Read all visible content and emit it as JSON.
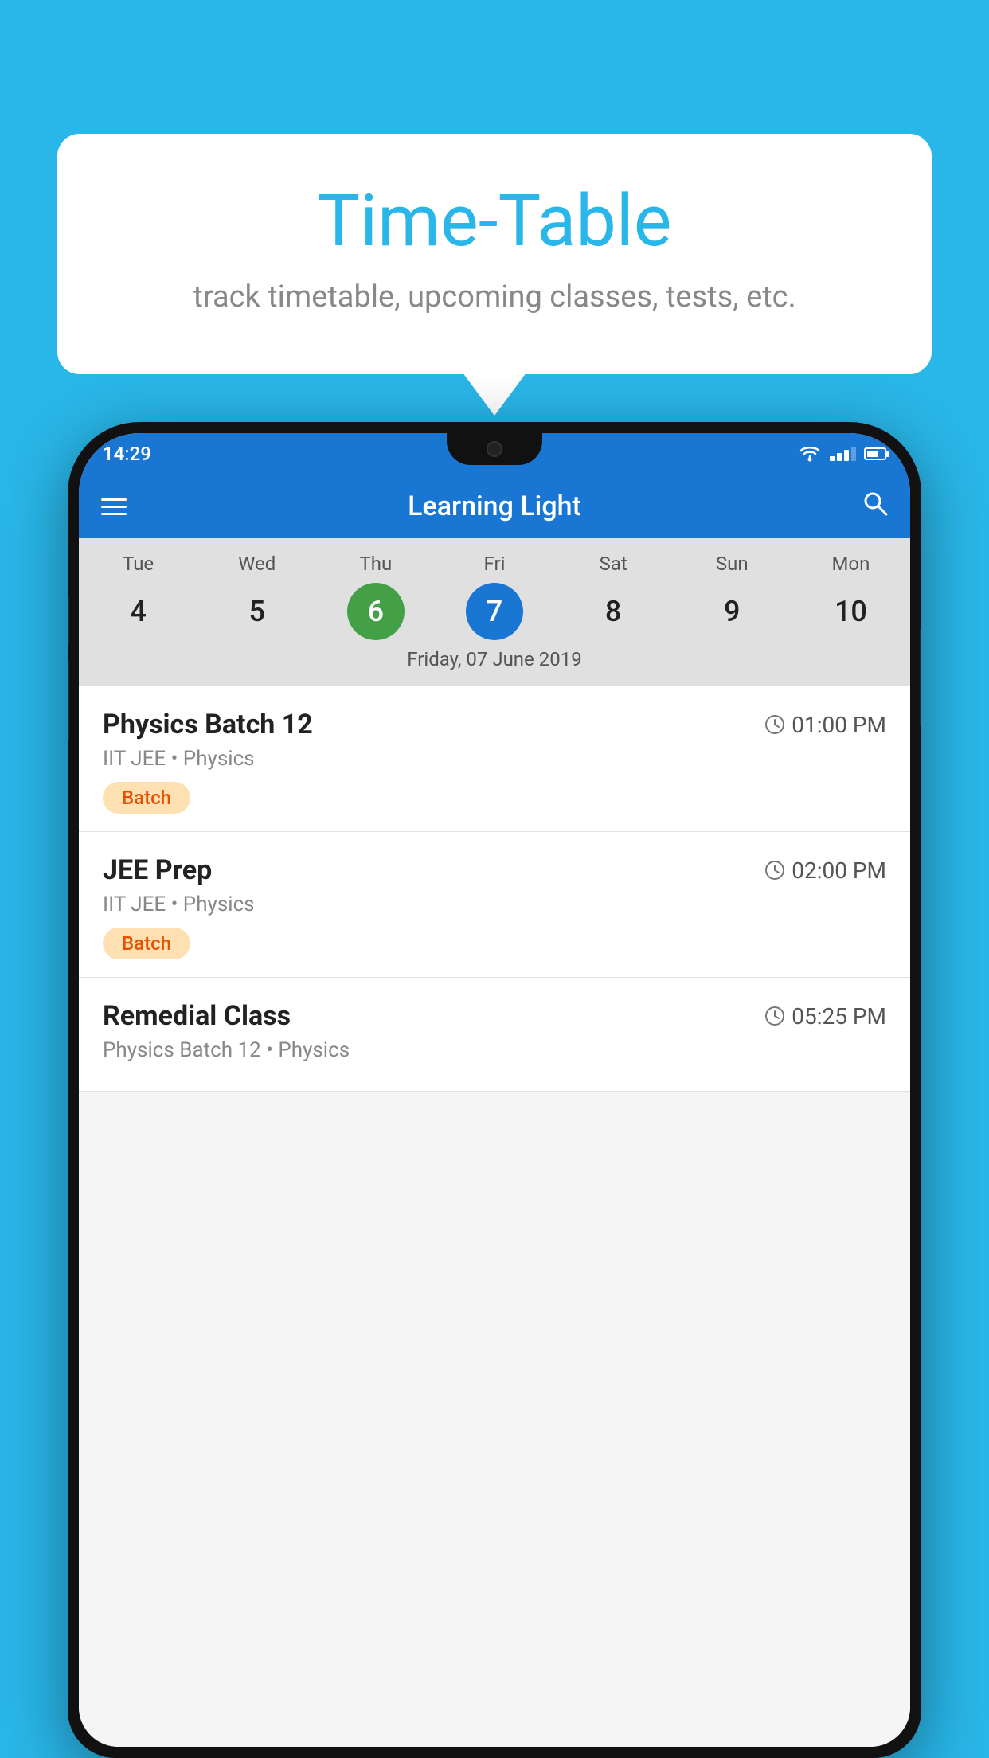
{
  "background_color": "#29b6e8",
  "bubble": {
    "title": "Time-Table",
    "subtitle": "track timetable, upcoming classes, tests, etc."
  },
  "phone": {
    "status_bar": {
      "time": "14:29"
    },
    "toolbar": {
      "title": "Learning Light",
      "menu_icon": "menu-icon",
      "search_icon": "search-icon"
    },
    "calendar": {
      "days": [
        "Tue",
        "Wed",
        "Thu",
        "Fri",
        "Sat",
        "Sun",
        "Mon"
      ],
      "dates": [
        "4",
        "5",
        "6",
        "7",
        "8",
        "9",
        "10"
      ],
      "today_index": 2,
      "selected_index": 3,
      "date_label": "Friday, 07 June 2019"
    },
    "schedule": [
      {
        "name": "Physics Batch 12",
        "time": "01:00 PM",
        "sub": "IIT JEE • Physics",
        "tag": "Batch"
      },
      {
        "name": "JEE Prep",
        "time": "02:00 PM",
        "sub": "IIT JEE • Physics",
        "tag": "Batch"
      },
      {
        "name": "Remedial Class",
        "time": "05:25 PM",
        "sub": "Physics Batch 12 • Physics",
        "tag": ""
      }
    ]
  }
}
